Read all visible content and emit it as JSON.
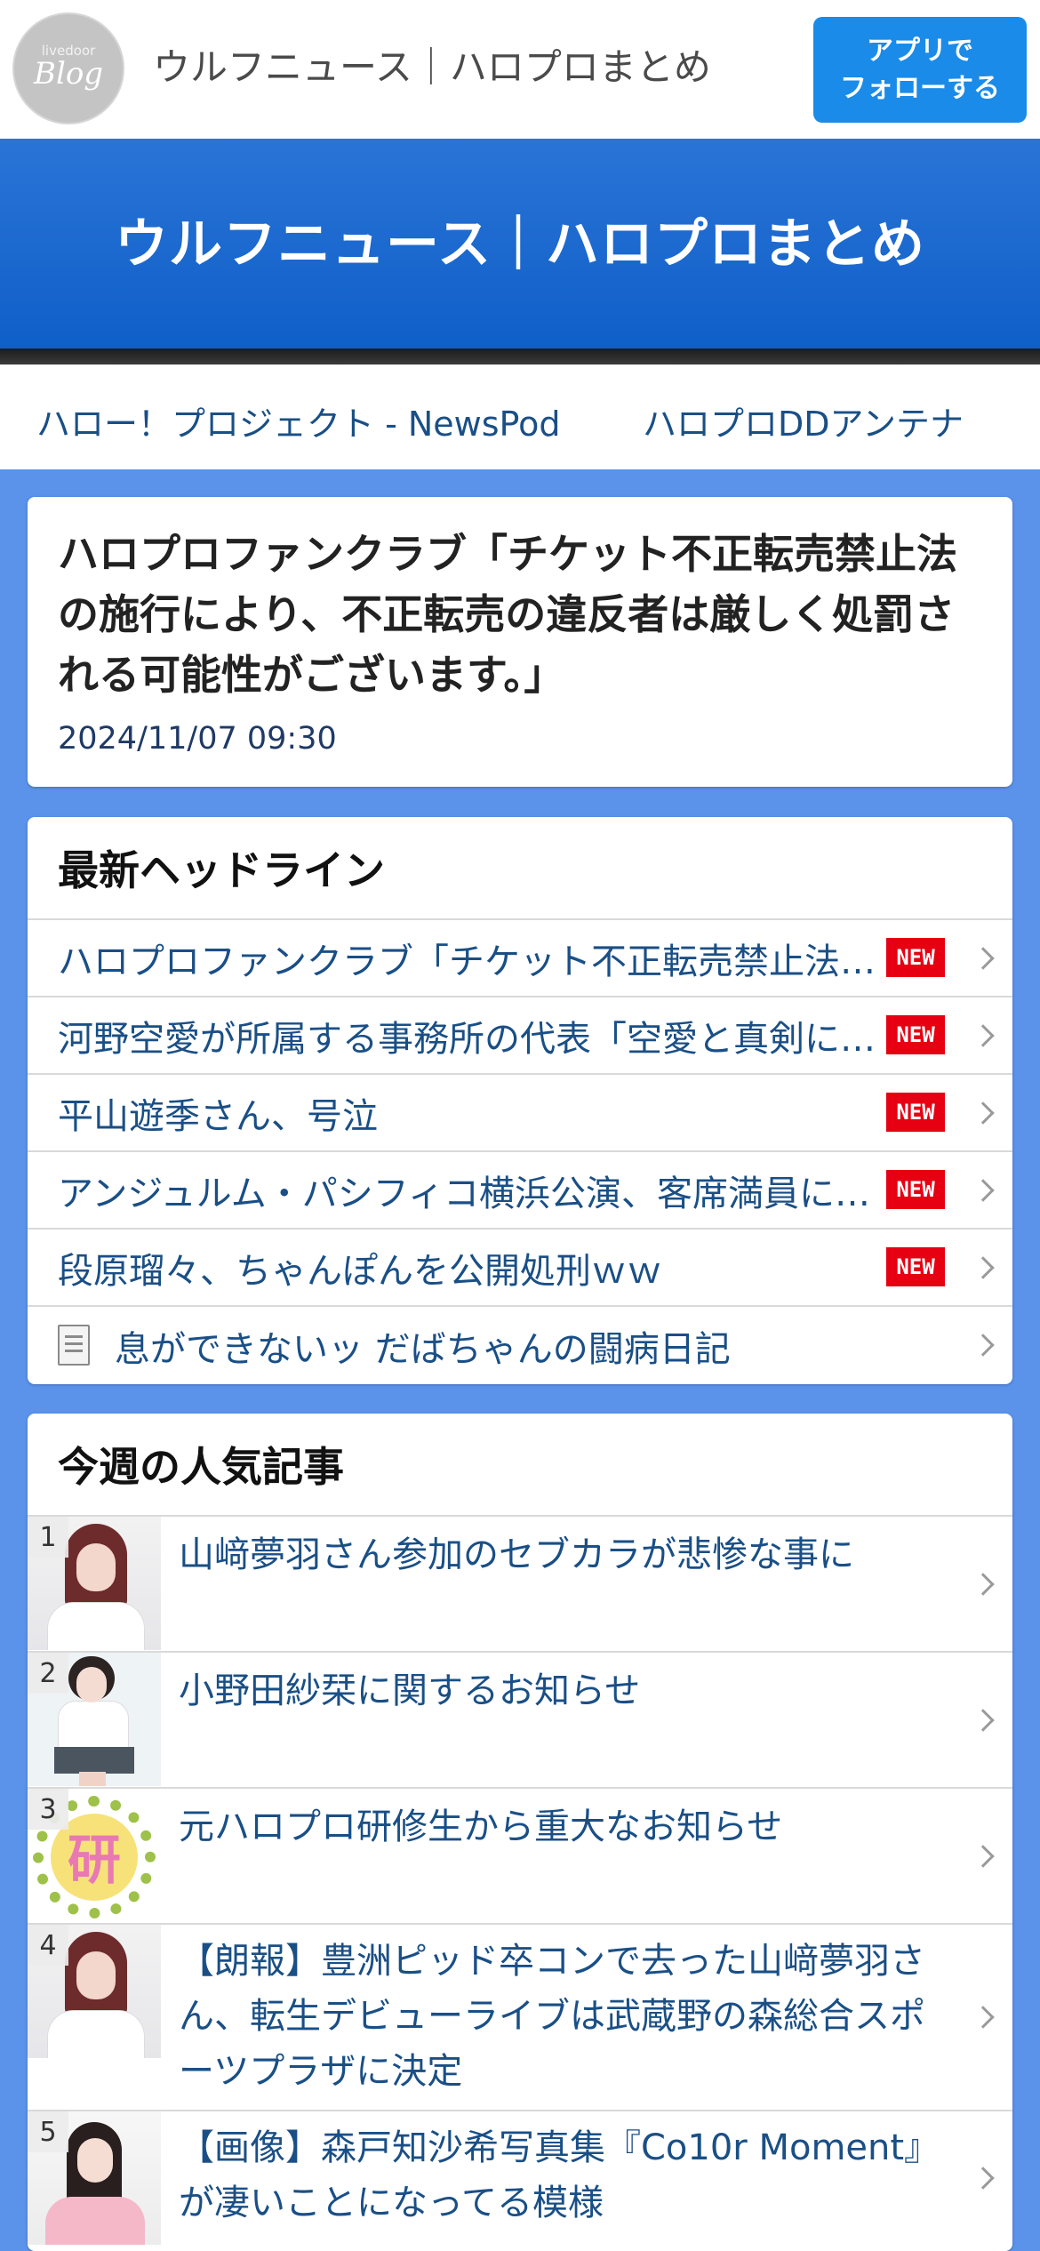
{
  "topbar": {
    "logo_small": "livedoor",
    "logo_big": "Blog",
    "title": "ウルフニュース｜ハロプロまとめ",
    "follow_button": "アプリで\nフォローする"
  },
  "hero": {
    "title": "ウルフニュース｜ハロプロまとめ"
  },
  "links": [
    "ハロー！プロジェクト - NewsPod",
    "ハロプロDDアンテナ"
  ],
  "article": {
    "title": "ハロプロファンクラブ「チケット不正転売禁止法の施行により、不正転売の違反者は厳しく処罰される可能性がございます。」",
    "date": "2024/11/07 09:30"
  },
  "headlines": {
    "heading": "最新ヘッドライン",
    "new_label": "NEW",
    "items": [
      "ハロプロファンクラブ「チケット不正転売禁止法の施行により、不正転売の違反者は厳しく処罰される可能性がございます。」",
      "河野空愛が所属する事務所の代表「空愛と真剣に向き合います」",
      "平山遊季さん、号泣",
      "アンジュルム・パシフィコ横浜公演、客席満員にならず",
      "段原瑠々、ちゃんぽんを公開処刑ｗｗ",
      "息ができないッ だばちゃんの闘病日記"
    ]
  },
  "popular": {
    "heading": "今週の人気記事",
    "items": [
      {
        "rank": "1",
        "title": "山﨑夢羽さん参加のセブカラが悲惨な事に"
      },
      {
        "rank": "2",
        "title": "小野田紗栞に関するお知らせ"
      },
      {
        "rank": "3",
        "title": "元ハロプロ研修生から重大なお知らせ"
      },
      {
        "rank": "4",
        "title": "【朗報】豊洲ピッド卒コンで去った山﨑夢羽さん、転生デビューライブは武蔵野の森総合スポーツプラザに決定"
      },
      {
        "rank": "5",
        "title": "【画像】森戸知沙希写真集『Co10r Moment』が凄いことになってる模様"
      }
    ],
    "thumb_kanji": "研"
  },
  "colors": {
    "header_blue": "#1a8be8",
    "hero_blue": "#1565cf",
    "page_bg": "#5b93eb",
    "link": "#1a4f86",
    "new_badge": "#e60012"
  }
}
